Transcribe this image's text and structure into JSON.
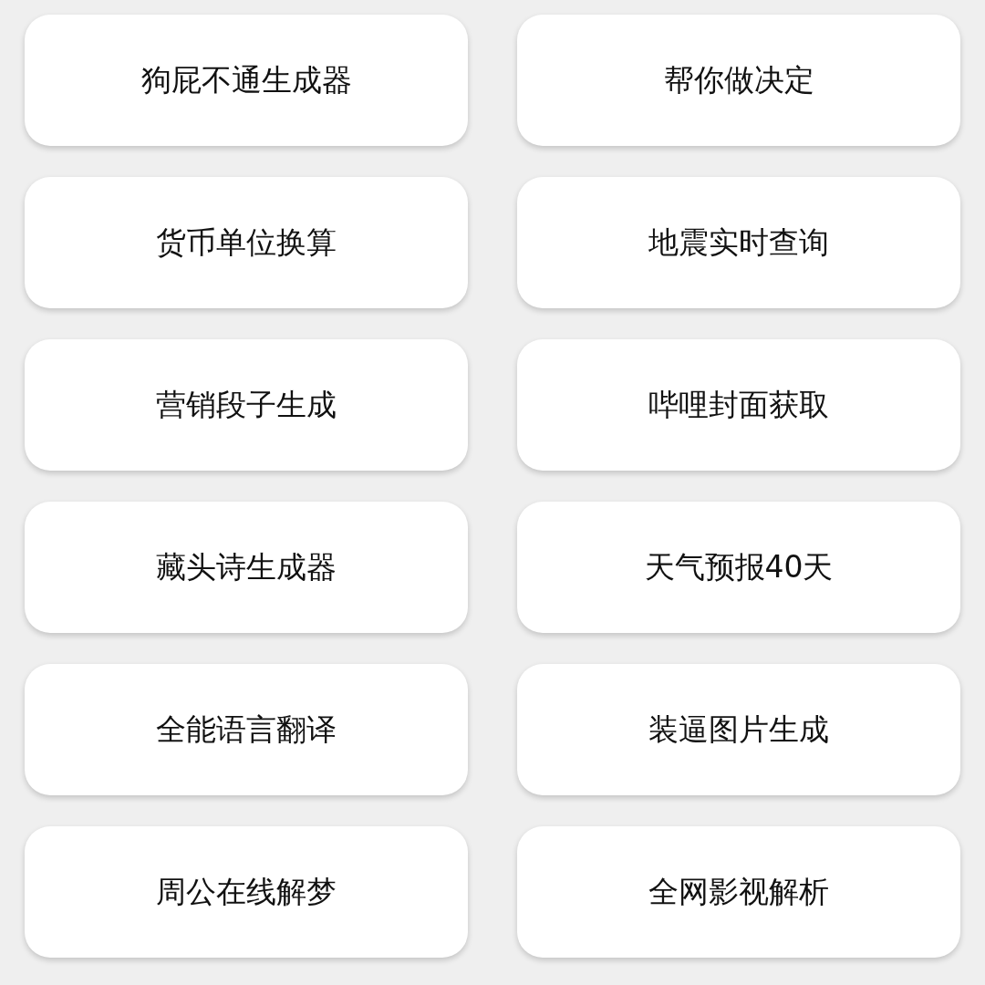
{
  "tools": [
    {
      "label": "狗屁不通生成器"
    },
    {
      "label": "帮你做决定"
    },
    {
      "label": "货币单位换算"
    },
    {
      "label": "地震实时查询"
    },
    {
      "label": "营销段子生成"
    },
    {
      "label": "哔哩封面获取"
    },
    {
      "label": "藏头诗生成器"
    },
    {
      "label": "天气预报40天"
    },
    {
      "label": "全能语言翻译"
    },
    {
      "label": "装逼图片生成"
    },
    {
      "label": "周公在线解梦"
    },
    {
      "label": "全网影视解析"
    }
  ]
}
